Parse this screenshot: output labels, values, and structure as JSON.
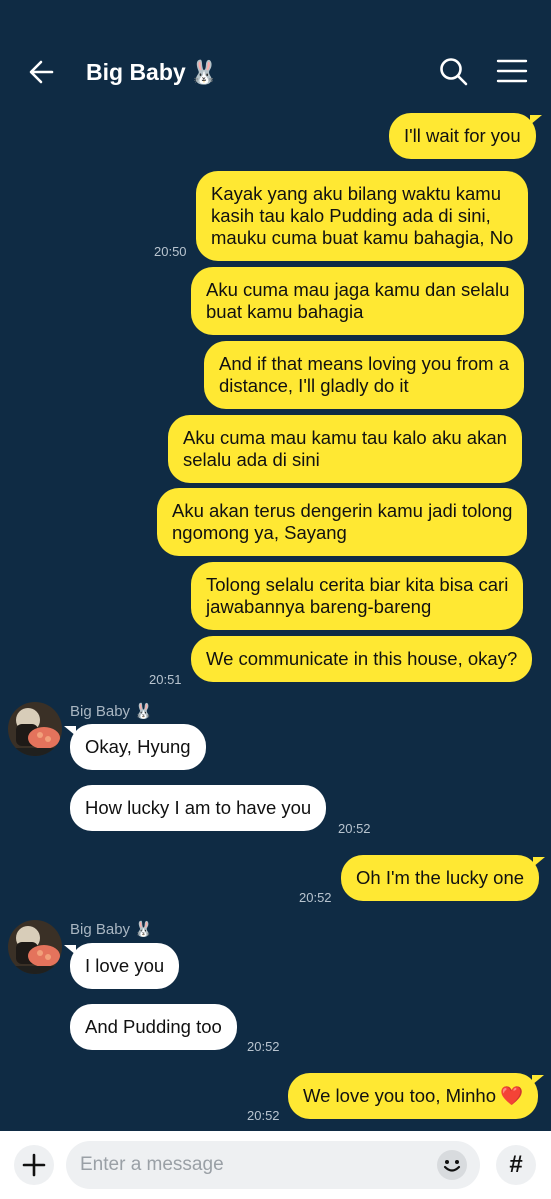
{
  "header": {
    "title": "Big Baby",
    "title_emoji": "🐰",
    "back_icon": "arrow-left-icon",
    "search_icon": "search-icon",
    "menu_icon": "hamburger-menu-icon"
  },
  "colors": {
    "background": "#0f2b44",
    "my_bubble": "#ffe833",
    "their_bubble": "#ffffff"
  },
  "messages": {
    "m1": {
      "text": "I'll wait for you"
    },
    "m2": {
      "lines": [
        "Kayak yang aku bilang waktu kamu",
        "kasih tau kalo Pudding ada di sini,",
        "mauku cuma buat kamu bahagia, No"
      ],
      "time": "20:50"
    },
    "m3": {
      "lines": [
        "Aku cuma mau jaga kamu dan selalu",
        "buat kamu bahagia"
      ]
    },
    "m4": {
      "lines": [
        "And if that means loving you from a",
        "distance, I'll gladly do it"
      ]
    },
    "m5": {
      "lines": [
        "Aku cuma mau kamu tau kalo aku akan",
        "selalu ada di sini"
      ]
    },
    "m6": {
      "lines": [
        "Aku akan terus dengerin kamu jadi tolong",
        "ngomong ya, Sayang"
      ]
    },
    "m7": {
      "lines": [
        "Tolong selalu cerita biar kita bisa cari",
        "jawabannya bareng-bareng"
      ]
    },
    "m8": {
      "text": "We communicate in this house, okay?",
      "time": "20:51"
    },
    "g1_sender": "Big Baby 🐰",
    "t1": {
      "text": "Okay, Hyung"
    },
    "t2": {
      "text": "How lucky I am to have you",
      "time": "20:52"
    },
    "m9": {
      "text": "Oh I'm the lucky one",
      "time": "20:52"
    },
    "g2_sender": "Big Baby 🐰",
    "t3": {
      "text": "I love you"
    },
    "t4": {
      "text": "And Pudding too",
      "time": "20:52"
    },
    "m10": {
      "text": "We love you too, Minho",
      "emoji": "❤️",
      "time": "20:52"
    }
  },
  "composer": {
    "placeholder": "Enter a message",
    "plus_icon": "plus-icon",
    "emoji_icon": "emoji-face-icon",
    "hash_label": "#"
  }
}
